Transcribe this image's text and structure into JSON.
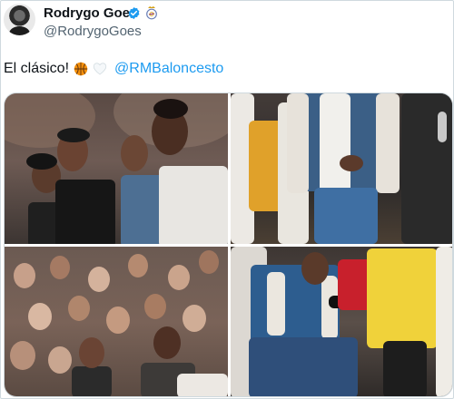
{
  "author": {
    "display_name": "Rodrygo Goes",
    "handle": "@RodrygoGoes",
    "verified_icon": "verified-badge-icon",
    "affiliation_icon": "real-madrid-crest-icon"
  },
  "tweet": {
    "text": "El clásico!",
    "emojis": [
      "basketball-icon",
      "white-heart-icon"
    ],
    "mention": "@RMBaloncesto"
  },
  "media": {
    "photo_count": 4,
    "photos": [
      "photo-courtside-group",
      "photo-walking-jackets",
      "photo-crowd",
      "photo-phone-selfie"
    ]
  },
  "colors": {
    "link": "#1d9bf0",
    "secondary_text": "#536471",
    "border": "#cfd9de"
  }
}
